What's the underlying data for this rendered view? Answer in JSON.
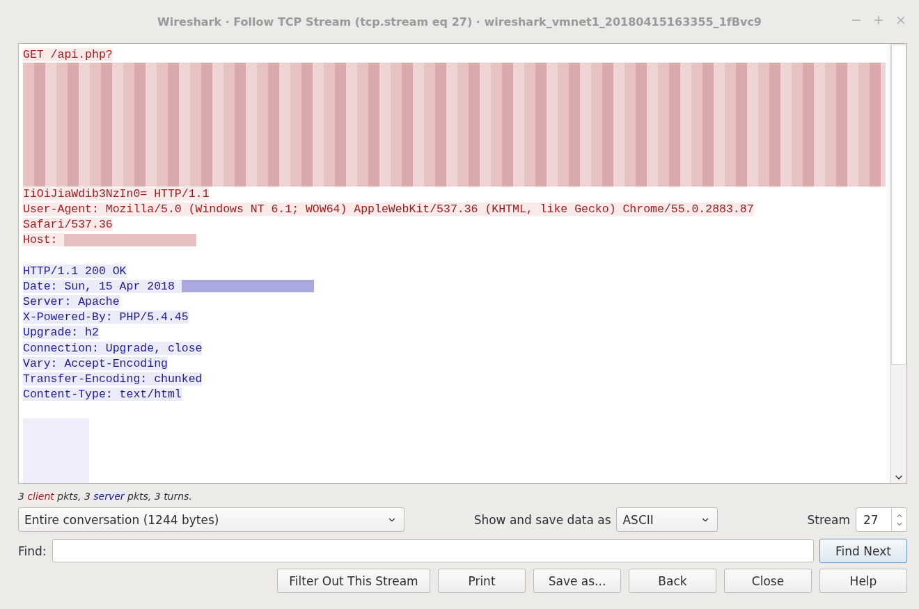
{
  "window": {
    "title": "Wireshark · Follow TCP Stream (tcp.stream eq 27) · wireshark_vmnet1_20180415163355_1fBvc9"
  },
  "stream": {
    "client": [
      {
        "kind": "text",
        "text": "GET /api.php?"
      },
      {
        "kind": "redacted"
      },
      {
        "kind": "redacted"
      },
      {
        "kind": "redacted"
      },
      {
        "kind": "redacted"
      },
      {
        "kind": "redacted"
      },
      {
        "kind": "redacted"
      },
      {
        "kind": "redacted"
      },
      {
        "kind": "redacted"
      },
      {
        "kind": "text",
        "text": "IiOiJiaWdib3NzIn0= HTTP/1.1"
      },
      {
        "kind": "text",
        "text": "User-Agent: Mozilla/5.0 (Windows NT 6.1; WOW64) AppleWebKit/537.36 (KHTML, like Gecko) Chrome/55.0.2883.87"
      },
      {
        "kind": "text",
        "text": "Safari/537.36"
      },
      {
        "kind": "text",
        "text": "Host: ",
        "redacted_tail": true
      },
      {
        "kind": "blank"
      }
    ],
    "server": [
      {
        "kind": "text",
        "text": "HTTP/1.1 200 OK"
      },
      {
        "kind": "text",
        "text": "Date: Sun, 15 Apr 2018 ",
        "redacted_tail": true
      },
      {
        "kind": "text",
        "text": "Server: Apache"
      },
      {
        "kind": "text",
        "text": "X-Powered-By: PHP/5.4.45"
      },
      {
        "kind": "text",
        "text": "Upgrade: h2"
      },
      {
        "kind": "text",
        "text": "Connection: Upgrade, close"
      },
      {
        "kind": "text",
        "text": "Vary: Accept-Encoding"
      },
      {
        "kind": "text",
        "text": "Transfer-Encoding: chunked"
      },
      {
        "kind": "text",
        "text": "Content-Type: text/html"
      },
      {
        "kind": "blank"
      },
      {
        "kind": "redacted"
      },
      {
        "kind": "redacted"
      },
      {
        "kind": "redacted"
      },
      {
        "kind": "redacted"
      },
      {
        "kind": "redacted"
      }
    ]
  },
  "summary": [
    {
      "kind": "plain",
      "text": "3 "
    },
    {
      "kind": "client",
      "text": "client"
    },
    {
      "kind": "plain",
      "text": " pkts, 3 "
    },
    {
      "kind": "server",
      "text": "server"
    },
    {
      "kind": "plain",
      "text": " pkts, 3 turns."
    }
  ],
  "conversation_select": {
    "value": "Entire conversation (1244 bytes)"
  },
  "format": {
    "label": "Show and save data as",
    "value": "ASCII"
  },
  "stream_number": {
    "label": "Stream",
    "value": "27"
  },
  "find": {
    "label": "Find:",
    "button": "Find Next",
    "focused": true
  },
  "buttons": [
    "Filter Out This Stream",
    "Print",
    "Save as...",
    "Back",
    "Close",
    "Help"
  ]
}
